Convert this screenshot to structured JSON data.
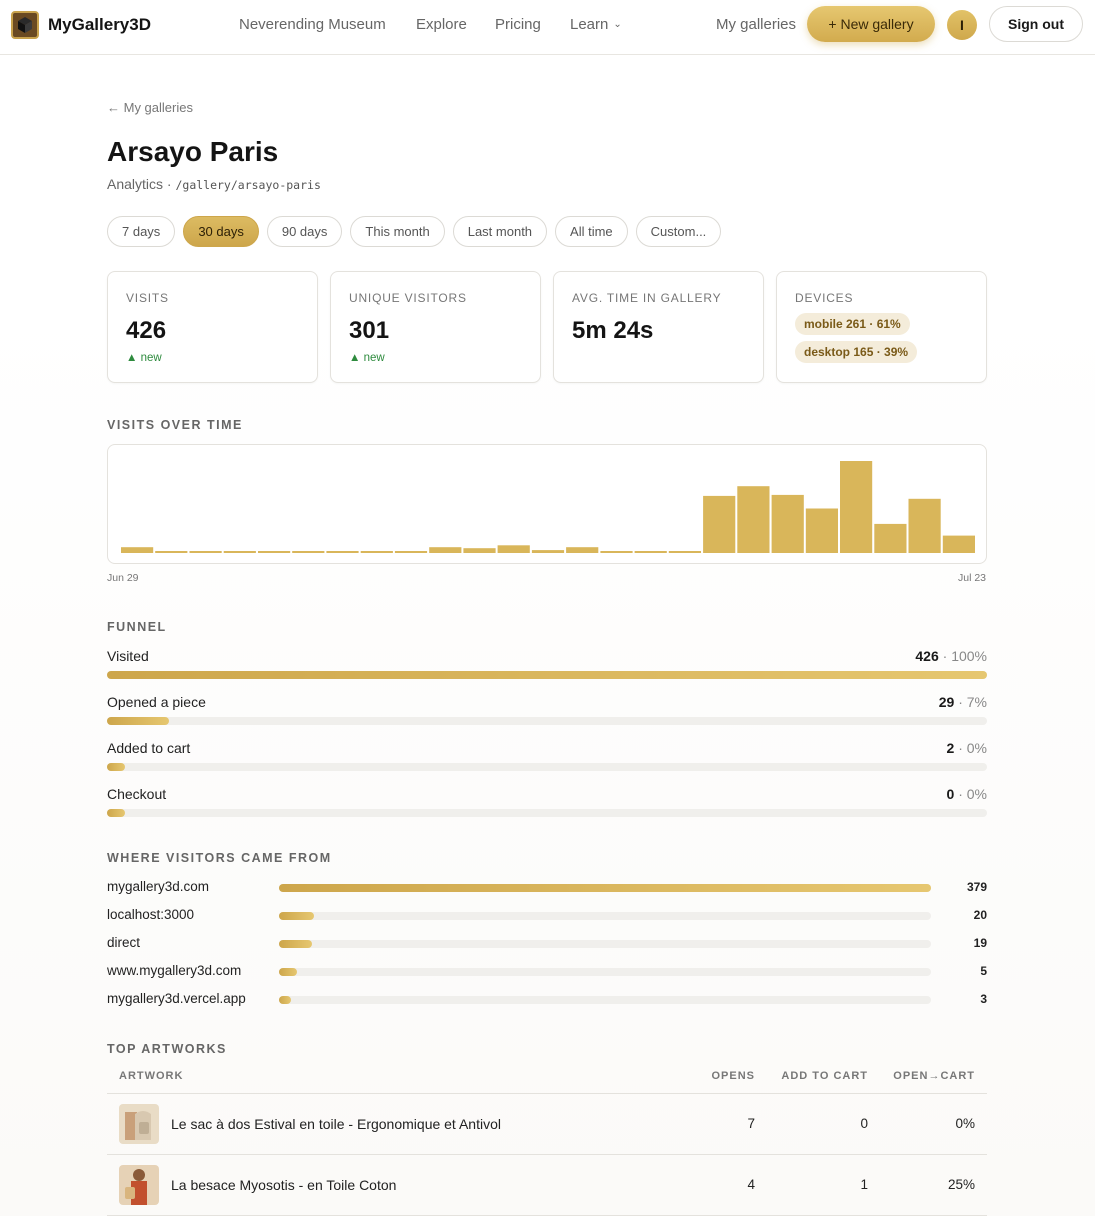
{
  "nav": {
    "brand": "MyGallery3D",
    "links": [
      "Neverending Museum",
      "Explore",
      "Pricing",
      "Learn"
    ],
    "my_galleries": "My galleries",
    "new_gallery": "+ New gallery",
    "avatar_initial": "I",
    "sign_out": "Sign out"
  },
  "header": {
    "back": "← My galleries",
    "title": "Arsayo Paris",
    "subtitle_prefix": "Analytics · ",
    "path": "/gallery/arsayo-paris"
  },
  "ranges": [
    "7 days",
    "30 days",
    "90 days",
    "This month",
    "Last month",
    "All time",
    "Custom..."
  ],
  "active_range": "30 days",
  "stats": {
    "visits": {
      "label": "VISITS",
      "value": "426",
      "delta": "▲ new"
    },
    "unique": {
      "label": "UNIQUE VISITORS",
      "value": "301",
      "delta": "▲ new"
    },
    "avg_time": {
      "label": "AVG. TIME IN GALLERY",
      "value": "5m 24s"
    },
    "devices": {
      "label": "DEVICES",
      "mobile": "mobile 261 · 61%",
      "desktop": "desktop 165 · 39%"
    }
  },
  "sections": {
    "visits_over_time": "VISITS OVER TIME",
    "funnel": "FUNNEL",
    "sources": "WHERE VISITORS CAME FROM",
    "top_artworks": "TOP ARTWORKS"
  },
  "chart_data": {
    "type": "bar",
    "x_start": "Jun 29",
    "x_end": "Jul 23",
    "values": [
      6,
      1,
      1,
      1,
      1,
      1,
      1,
      1,
      1,
      6,
      5,
      8,
      3,
      6,
      1,
      1,
      1,
      59,
      69,
      60,
      46,
      95,
      30,
      56,
      18
    ],
    "color": "#d9b65a"
  },
  "funnel": [
    {
      "label": "Visited",
      "count": "426",
      "pct": " · 100%",
      "fraction": 1.0
    },
    {
      "label": "Opened a piece",
      "count": "29",
      "pct": " · 7%",
      "fraction": 0.07
    },
    {
      "label": "Added to cart",
      "count": "2",
      "pct": " · 0%",
      "fraction": 0.005
    },
    {
      "label": "Checkout",
      "count": "0",
      "pct": " · 0%",
      "fraction": 0.0
    }
  ],
  "sources": [
    {
      "name": "mygallery3d.com",
      "count": "379",
      "fraction": 1.0
    },
    {
      "name": "localhost:3000",
      "count": "20",
      "fraction": 0.053
    },
    {
      "name": "direct",
      "count": "19",
      "fraction": 0.05
    },
    {
      "name": "www.mygallery3d.com",
      "count": "5",
      "fraction": 0.013
    },
    {
      "name": "mygallery3d.vercel.app",
      "count": "3",
      "fraction": 0.008
    }
  ],
  "table": {
    "headers": [
      "ARTWORK",
      "OPENS",
      "ADD TO CART",
      "OPEN→CART"
    ],
    "rows": [
      {
        "title": "Le sac à dos Estival en toile - Ergonomique et Antivol",
        "opens": "7",
        "add_to_cart": "0",
        "open_cart": "0%"
      },
      {
        "title": "La besace Myosotis - en Toile Coton",
        "opens": "4",
        "add_to_cart": "1",
        "open_cart": "25%"
      }
    ]
  }
}
